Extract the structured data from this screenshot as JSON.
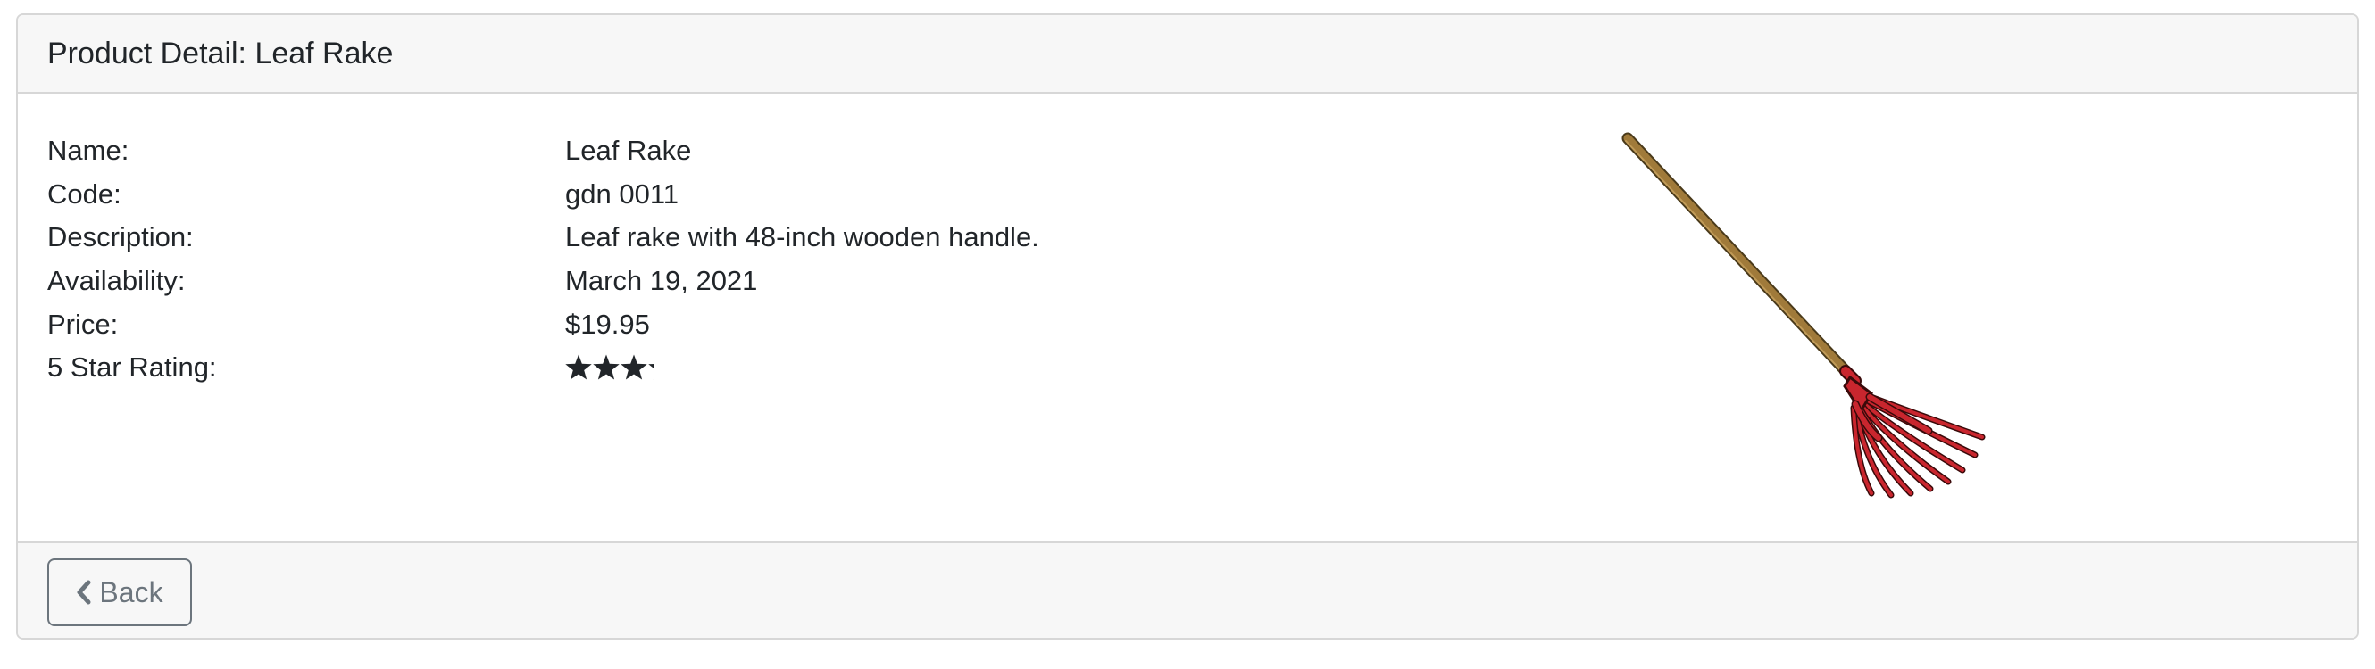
{
  "header": {
    "title": "Product Detail: Leaf Rake"
  },
  "product": {
    "fields": [
      {
        "label": "Name:",
        "value": "Leaf Rake"
      },
      {
        "label": "Code:",
        "value": "gdn 0011"
      },
      {
        "label": "Description:",
        "value": "Leaf rake with 48-inch wooden handle."
      },
      {
        "label": "Availability:",
        "value": "March 19, 2021"
      },
      {
        "label": "Price:",
        "value": "$19.95"
      }
    ],
    "rating": {
      "label": "5 Star Rating:",
      "value": 3.2,
      "max": 5,
      "icon": "star-icon"
    },
    "image": {
      "icon": "leaf-rake-image",
      "colors": {
        "handle": "#a07a3a",
        "handle_outline": "#4a3a1a",
        "rake_head": "#c9262e",
        "rake_outline": "#3a0a0a"
      }
    }
  },
  "footer": {
    "back_label": "Back",
    "back_icon": "chevron-left-icon"
  }
}
